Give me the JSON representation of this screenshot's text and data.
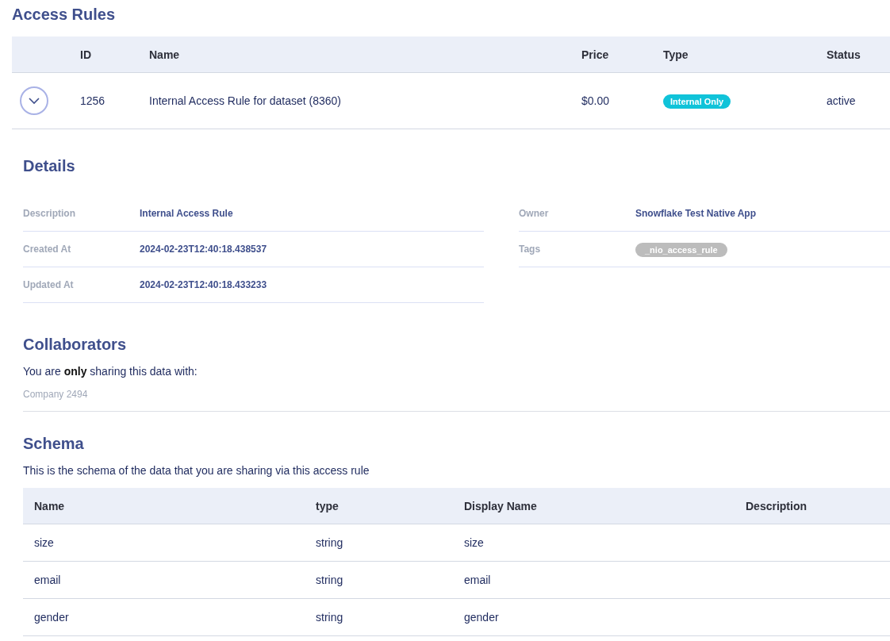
{
  "title": "Access Rules",
  "rules_table": {
    "columns": [
      "ID",
      "Name",
      "Price",
      "Type",
      "Status"
    ],
    "rows": [
      {
        "expanded": true,
        "id": "1256",
        "name": "Internal Access Rule for dataset (8360)",
        "price": "$0.00",
        "type": "Internal Only",
        "status": "active"
      }
    ]
  },
  "details": {
    "title": "Details",
    "left": [
      {
        "label": "Description",
        "value": "Internal Access Rule"
      },
      {
        "label": "Created At",
        "value": "2024-02-23T12:40:18.438537"
      },
      {
        "label": "Updated At",
        "value": "2024-02-23T12:40:18.433233"
      }
    ],
    "right": [
      {
        "label": "Owner",
        "value": "Snowflake Test Native App"
      },
      {
        "label": "Tags",
        "tags": [
          "_nio_access_rule"
        ]
      }
    ]
  },
  "collaborators": {
    "title": "Collaborators",
    "text": "You are **only** sharing this data with:",
    "companies": [
      "Company 2494"
    ]
  },
  "schema": {
    "title": "Schema",
    "text": "This is the schema of the data that you are sharing via this access rule",
    "columns": [
      "Name",
      "type",
      "Display Name",
      "Description"
    ],
    "rows": [
      [
        "size",
        "string",
        "size",
        ""
      ],
      [
        "email",
        "string",
        "email",
        ""
      ],
      [
        "gender",
        "string",
        "gender",
        ""
      ]
    ]
  }
}
